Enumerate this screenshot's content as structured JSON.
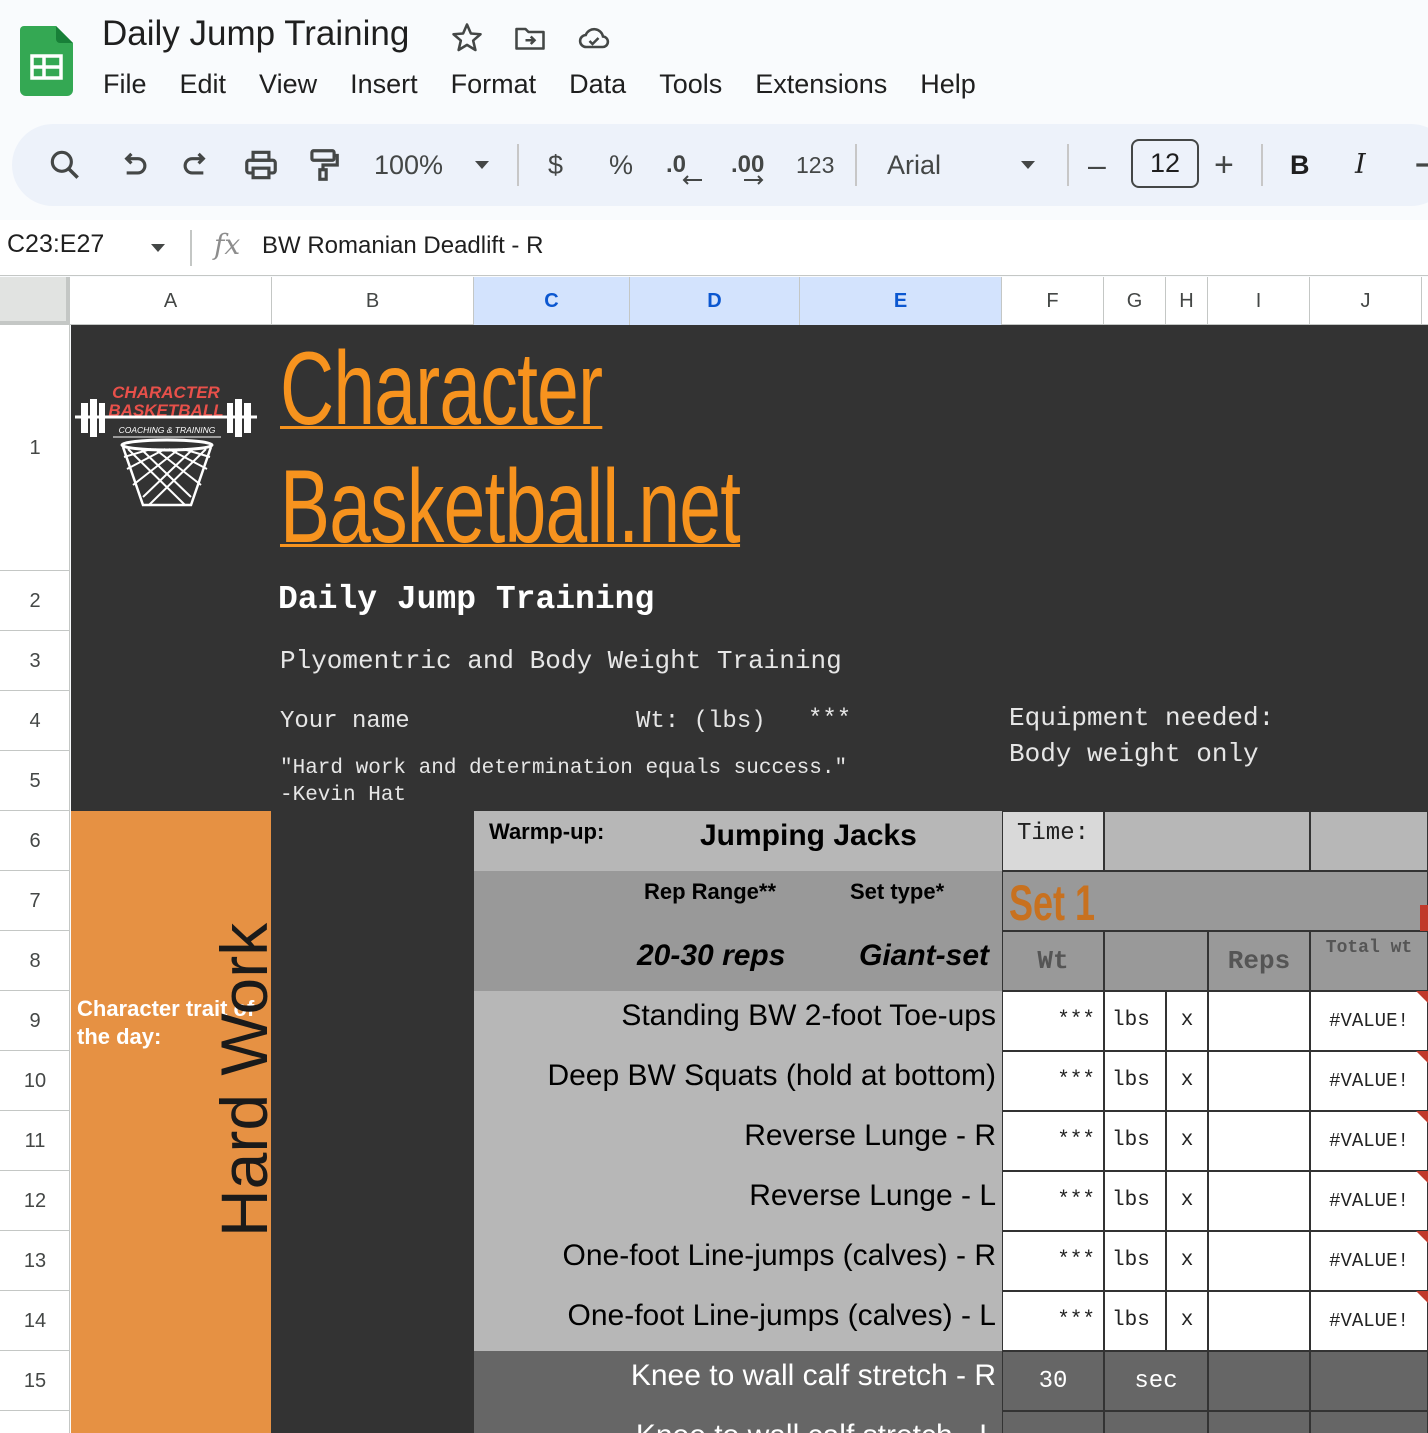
{
  "app": {
    "doc_title": "Daily Jump Training",
    "menu": [
      "File",
      "Edit",
      "View",
      "Insert",
      "Format",
      "Data",
      "Tools",
      "Extensions",
      "Help"
    ],
    "icons": [
      "sheets-logo-icon",
      "star-icon",
      "move-folder-icon",
      "cloud-saved-icon"
    ]
  },
  "toolbar": {
    "zoom": "100%",
    "currency": "$",
    "percent": "%",
    "decrease_decimal": ".0",
    "increase_decimal": ".00",
    "number_format": "123",
    "font": "Arial",
    "font_size": "12",
    "minus": "–",
    "plus": "+",
    "bold": "B",
    "italic": "I"
  },
  "formula_bar": {
    "name_box": "C23:E27",
    "fx": "fx",
    "formula": "BW Romanian Deadlift - R"
  },
  "columns": [
    "A",
    "B",
    "C",
    "D",
    "E",
    "F",
    "G",
    "H",
    "I",
    "J"
  ],
  "selected_columns": [
    "C",
    "D",
    "E"
  ],
  "rows": [
    "1",
    "2",
    "3",
    "4",
    "5",
    "6",
    "7",
    "8",
    "9",
    "10",
    "11",
    "12",
    "13",
    "14",
    "15"
  ],
  "sheet": {
    "logo_text_1": "CHARACTER",
    "logo_text_2": "BASKETBALL",
    "logo_text_3": "COACHING & TRAINING",
    "brand_line1": "Character",
    "brand_line2": "Basketball.net",
    "title": "Daily Jump Training",
    "subtitle": "Plyomentric and Body Weight Training",
    "your_name": "Your name",
    "wt_label": "Wt: (lbs)",
    "wt_value": "***",
    "equipment": "Equipment needed:  Body weight only",
    "quote_line1": "\"Hard work and determination equals success.\"",
    "quote_line2": "-Kevin Hat",
    "character_trait": "Character trait of the day:",
    "vertical_text": "Hard Work",
    "warmup_label": "Warmp-up:",
    "warmup_value": "Jumping Jacks",
    "time_label": "Time:",
    "rep_range_label": "Rep Range**",
    "set_type_label": "Set type*",
    "rep_range_value": "20-30 reps",
    "set_type_value": "Giant-set",
    "set_label": "Set 1",
    "wt_header": "Wt",
    "reps_header": "Reps",
    "total_header": "Total wt",
    "exercises": [
      {
        "name": "Standing BW 2-foot Toe-ups",
        "wt": "***",
        "unit": "lbs",
        "x": "x",
        "total": "#VALUE!"
      },
      {
        "name": "Deep BW Squats (hold at bottom)",
        "wt": "***",
        "unit": "lbs",
        "x": "x",
        "total": "#VALUE!"
      },
      {
        "name": "Reverse Lunge - R",
        "wt": "***",
        "unit": "lbs",
        "x": "x",
        "total": "#VALUE!"
      },
      {
        "name": "Reverse Lunge - L",
        "wt": "***",
        "unit": "lbs",
        "x": "x",
        "total": "#VALUE!"
      },
      {
        "name": "One-foot Line-jumps (calves) - R",
        "wt": "***",
        "unit": "lbs",
        "x": "x",
        "total": "#VALUE!"
      },
      {
        "name": "One-foot Line-jumps (calves) - L",
        "wt": "***",
        "unit": "lbs",
        "x": "x",
        "total": "#VALUE!"
      }
    ],
    "stretch_1": "Knee to wall calf stretch - R",
    "stretch_1_value": "30",
    "stretch_1_unit": "sec",
    "stretch_2": "Knee to wall calf stretch - L",
    "colors": {
      "dark_bg": "#333333",
      "orange_text": "#f7931e",
      "orange_panel": "#e69143",
      "set_orange": "#c8711f",
      "light_gray": "#b7b7b7",
      "mid_gray": "#999999",
      "stretch_gray": "#666666"
    }
  }
}
